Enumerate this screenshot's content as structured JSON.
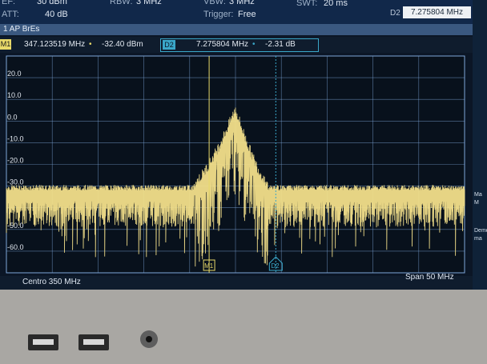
{
  "header": {
    "ref_label": "EF:",
    "ref_value": "30 dBm",
    "att_label": "ATT:",
    "att_value": "40 dB",
    "rbw_label": "RBW:",
    "rbw_value": "3 MHz",
    "vbw_label": "VBW:",
    "vbw_value": "3 MHz",
    "trigger_label": "Trigger:",
    "trigger_value": "Free",
    "swt_label": "SWT:",
    "swt_value": "20 ms",
    "d2_label": "D2",
    "d2_value": "7.275804 MHz"
  },
  "trace_bar": {
    "label": "1 AP BrEs"
  },
  "markers": {
    "m1": {
      "tag": "M1",
      "freq": "347.123519 MHz",
      "level": "-32.40 dBm"
    },
    "d2": {
      "tag": "D2",
      "freq": "7.275804 MHz",
      "level": "-2.31 dB"
    },
    "dot": "•"
  },
  "footer": {
    "center": "Centro 350 MHz",
    "span": "Span 50 MHz"
  },
  "side_panel": {
    "items": [
      "Ma",
      "M",
      "Demo",
      "ma"
    ]
  },
  "colors": {
    "screen_bg": "#0b1626",
    "header_bg": "#11284a",
    "trace": "#f2df8a",
    "m1": "#e8d969",
    "d2": "#3aa7c9",
    "grid": "#7ea6d9",
    "bezel": "#a9a7a3"
  },
  "chart_data": {
    "type": "line",
    "y_tick_labels": [
      "20.0",
      "10.0",
      "0.0",
      "-10.0",
      "-20.0",
      "-30.0",
      "-50.0",
      "-60.0"
    ],
    "y_tick_values": [
      20,
      10,
      0,
      -10,
      -20,
      -30,
      -50,
      -60
    ],
    "ylim": [
      -70,
      30
    ],
    "xlim": [
      325,
      375
    ],
    "x_unit": "MHz",
    "grid": true,
    "noise_floor_dbm": -33,
    "peak_dbm": 1,
    "peak_freq_mhz": 350,
    "occupied_band_mhz": [
      345.5,
      353.5
    ],
    "markers": [
      {
        "name": "M1",
        "freq_mhz": 347.123519,
        "level_dbm": -32.4
      },
      {
        "name": "D2",
        "freq_mhz": 354.399323,
        "level_db": -2.31
      }
    ]
  }
}
